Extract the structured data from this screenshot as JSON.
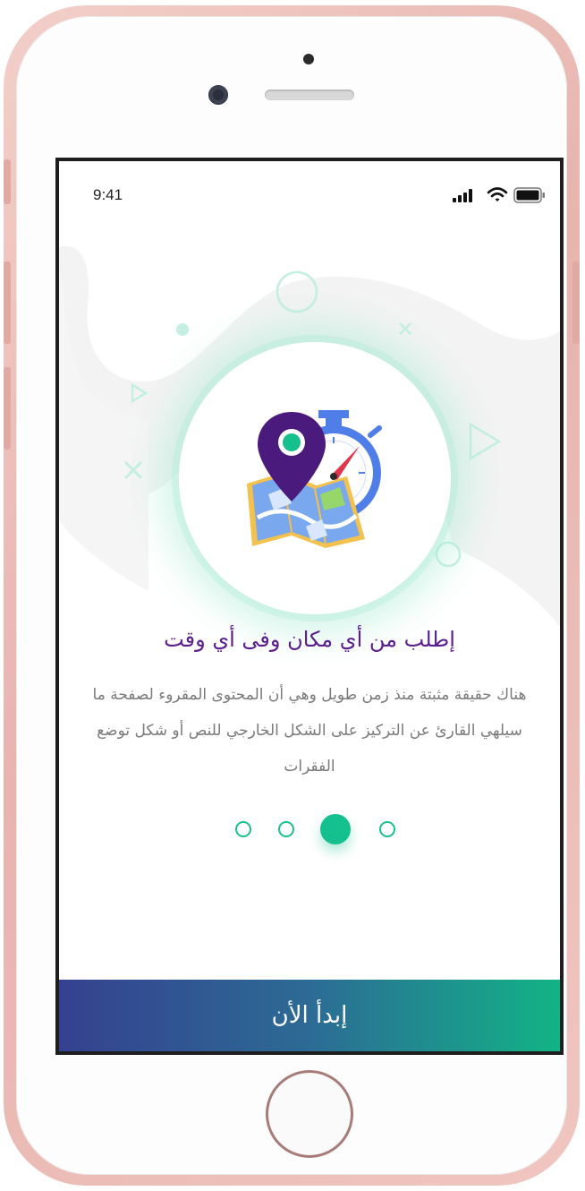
{
  "status_bar": {
    "time": "9:41",
    "icons": [
      "signal-icon",
      "wifi-icon",
      "battery-icon"
    ]
  },
  "onboarding": {
    "illustration": "map-pin-timer-illustration",
    "title": "إطلب من أي مكان وفى أي وقت",
    "description": "هناك حقيقة مثبتة منذ زمن طويل وهي أن المحتوى المقروء لصفحة ما سيلهي القارئ عن التركيز على الشكل الخارجي للنص أو شكل توضع الفقرات",
    "pager": {
      "total": 4,
      "active_index": 2
    },
    "start_button_label": "إبدأ الأن"
  },
  "colors": {
    "accent_green": "#14c08d",
    "title_purple": "#5a1f8f",
    "button_gradient_start": "#35418f",
    "button_gradient_end": "#12b386",
    "phone_frame_rose": "#e7b4ae"
  }
}
